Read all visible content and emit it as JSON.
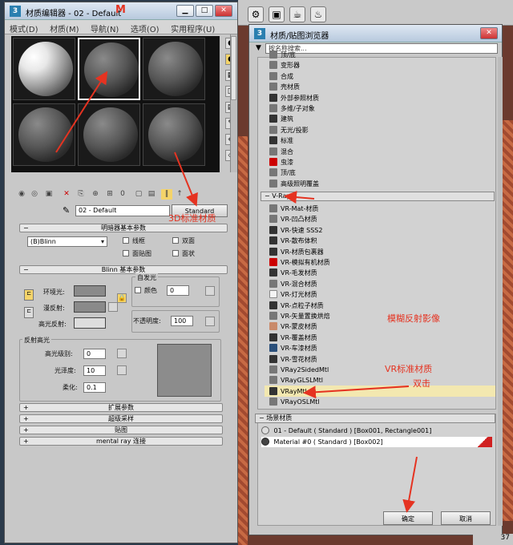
{
  "editor": {
    "title": "材质编辑器 - 02 - Default",
    "title_mark": "M",
    "menu": [
      "模式(D)",
      "材质(M)",
      "导航(N)",
      "选项(O)",
      "实用程序(U)"
    ],
    "material_name": "02 - Default",
    "type_button": "Standard",
    "shader_section": "明暗器基本参数",
    "shader_value": "(B)Blinn",
    "opt_wire": "线框",
    "opt_2sided": "双面",
    "opt_facemap": "面贴图",
    "opt_faceted": "面状",
    "blinn_section": "Blinn 基本参数",
    "self_illum_label": "自发光",
    "color_label": "颜色",
    "self_illum_value": "0",
    "ambient": "环境光:",
    "diffuse": "漫反射:",
    "specular": "高光反射:",
    "opacity_label": "不透明度:",
    "opacity_value": "100",
    "highlight_group": "反射高光",
    "spec_level_label": "高光级别:",
    "spec_level": "0",
    "gloss_label": "光泽度:",
    "gloss": "10",
    "soften_label": "柔化:",
    "soften": "0.1",
    "rollouts": [
      "扩展参数",
      "超级采样",
      "贴图",
      "mental ray 连接"
    ]
  },
  "browser": {
    "title": "材质/贴图浏览器",
    "search_placeholder": "按名称搜索...",
    "std_items": [
      {
        "label": "顶/底",
        "kind": "gray"
      },
      {
        "label": "变形器",
        "kind": "gray"
      },
      {
        "label": "合成",
        "kind": "gray"
      },
      {
        "label": "壳材质",
        "kind": "gray"
      },
      {
        "label": "外部参照材质",
        "kind": "dark"
      },
      {
        "label": "多维/子对象",
        "kind": "gray"
      },
      {
        "label": "建筑",
        "kind": "dark"
      },
      {
        "label": "无光/投影",
        "kind": "gray"
      },
      {
        "label": "标准",
        "kind": "dark"
      },
      {
        "label": "混合",
        "kind": "gray"
      },
      {
        "label": "虫漆",
        "kind": "red"
      },
      {
        "label": "顶/底",
        "kind": "gray"
      },
      {
        "label": "高级照明覆盖",
        "kind": "gray"
      }
    ],
    "vray_header": "V-Ray",
    "vray_items": [
      {
        "label": "VR-Mat-材质",
        "kind": "gray"
      },
      {
        "label": "VR-凹凸材质",
        "kind": "gray"
      },
      {
        "label": "VR-快速 SSS2",
        "kind": "dark"
      },
      {
        "label": "VR-散布体积",
        "kind": "dark"
      },
      {
        "label": "VR-材质包裹器",
        "kind": "dark"
      },
      {
        "label": "VR-模拟有机材质",
        "kind": "red"
      },
      {
        "label": "VR-毛发材质",
        "kind": "dark"
      },
      {
        "label": "VR-混合材质",
        "kind": "gray"
      },
      {
        "label": "VR-灯光材质",
        "kind": "white"
      },
      {
        "label": "VR-点粒子材质",
        "kind": "dark"
      },
      {
        "label": "VR-矢量置换烘焙",
        "kind": "gray"
      },
      {
        "label": "VR-蒙皮材质",
        "kind": "skin"
      },
      {
        "label": "VR-覆盖材质",
        "kind": "dark"
      },
      {
        "label": "VR-车漆材质",
        "kind": "blue"
      },
      {
        "label": "VR-雪花材质",
        "kind": "dark"
      },
      {
        "label": "VRay2SidedMtl",
        "kind": "gray"
      },
      {
        "label": "VRayGLSLMtl",
        "kind": "gray"
      },
      {
        "label": "VRayMtl",
        "kind": "dark"
      },
      {
        "label": "VRayOSLMtl",
        "kind": "gray"
      }
    ],
    "scene_header": "场景材质",
    "scene_items": [
      "01 - Default  ( Standard )  [Box001, Rectangle001]",
      "Material #0  ( Standard )  [Box002]"
    ],
    "ok": "确定",
    "cancel": "取消"
  },
  "annotations": {
    "std_material": "3D标准材质",
    "blur_reflect": "模糊反射影像",
    "vr_std_material": "VR标准材质",
    "double_click": "双击"
  },
  "corner_text": "37"
}
